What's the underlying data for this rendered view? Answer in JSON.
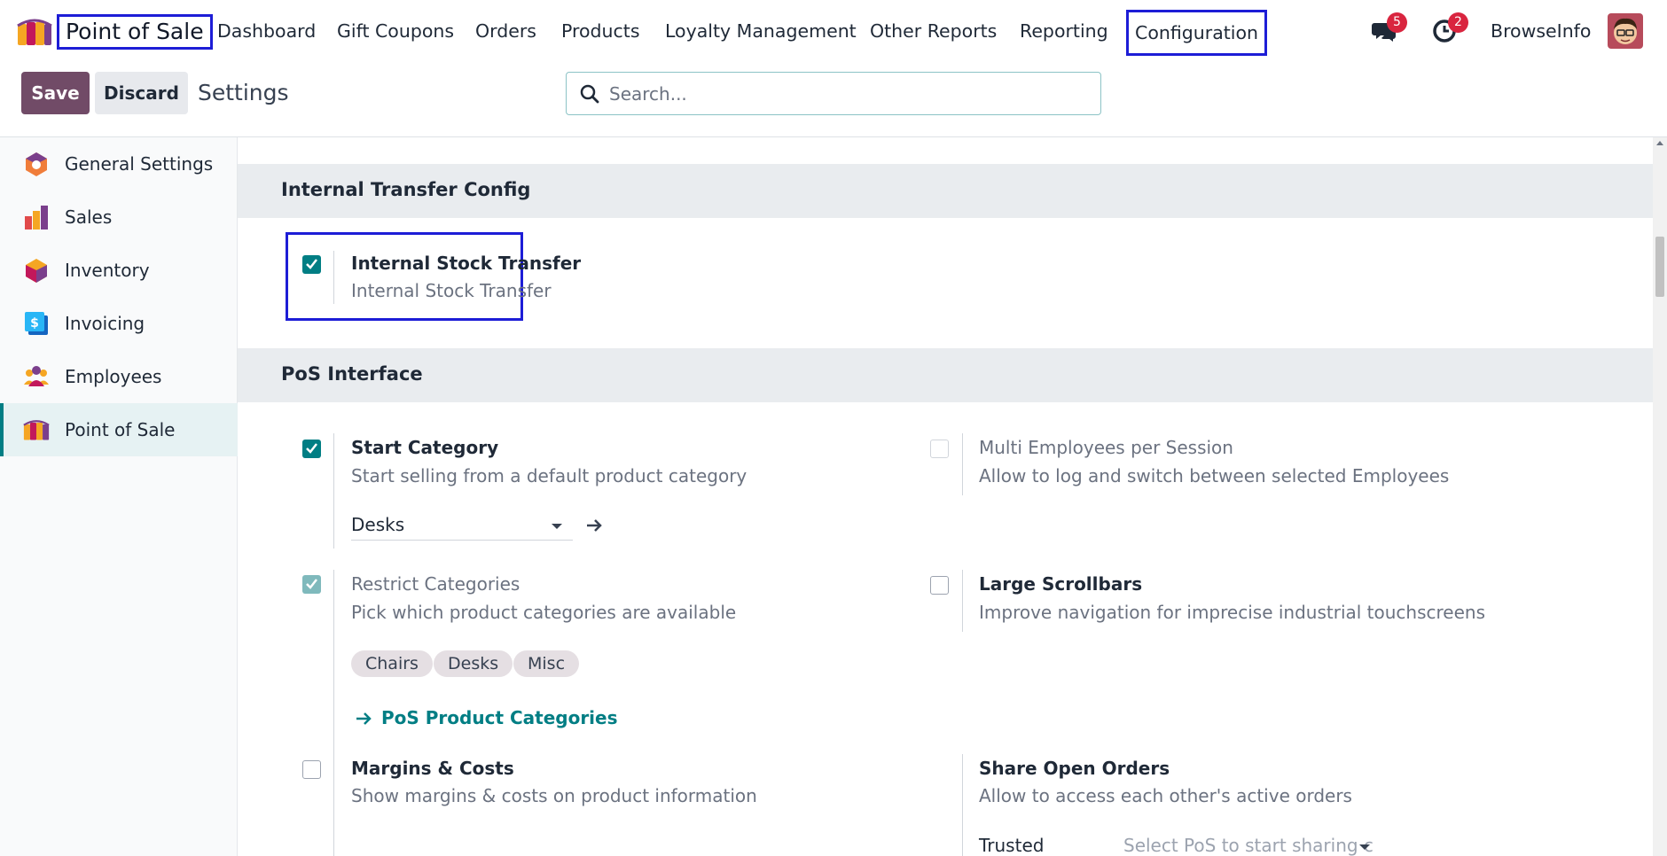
{
  "navbar": {
    "app_name": "Point of Sale",
    "menu": [
      "Dashboard",
      "Gift Coupons",
      "Orders",
      "Products",
      "Loyalty Management",
      "Other Reports",
      "Reporting",
      "Configuration"
    ],
    "messages_count": "5",
    "activities_count": "2",
    "company": "BrowseInfo"
  },
  "control_panel": {
    "save_label": "Save",
    "discard_label": "Discard",
    "breadcrumb": "Settings",
    "search_placeholder": "Search..."
  },
  "sidebar": {
    "items": [
      {
        "label": "General Settings",
        "icon": "general-settings-icon"
      },
      {
        "label": "Sales",
        "icon": "sales-icon"
      },
      {
        "label": "Inventory",
        "icon": "inventory-icon"
      },
      {
        "label": "Invoicing",
        "icon": "invoicing-icon"
      },
      {
        "label": "Employees",
        "icon": "employees-icon"
      },
      {
        "label": "Point of Sale",
        "icon": "point-of-sale-icon",
        "active": true
      }
    ]
  },
  "sections": {
    "internal_transfer": {
      "title": "Internal Transfer Config",
      "stock_transfer": {
        "title": "Internal Stock Transfer",
        "desc": "Internal Stock Transfer",
        "checked": true
      }
    },
    "pos_interface": {
      "title": "PoS Interface",
      "start_category": {
        "title": "Start Category",
        "desc": "Start selling from a default product category",
        "value": "Desks",
        "checked": true
      },
      "multi_employees": {
        "title": "Multi Employees per Session",
        "desc": "Allow to log and switch between selected Employees",
        "checked": false
      },
      "restrict_categories": {
        "title": "Restrict Categories",
        "desc": "Pick which product categories are available",
        "checked": true,
        "tags": [
          "Chairs",
          "Desks",
          "Misc"
        ],
        "link_label": "PoS Product Categories"
      },
      "large_scrollbars": {
        "title": "Large Scrollbars",
        "desc": "Improve navigation for imprecise industrial touchscreens",
        "checked": false
      },
      "margins_costs": {
        "title": "Margins & Costs",
        "desc": "Show margins & costs on product information",
        "checked": false
      },
      "share_open_orders": {
        "title": "Share Open Orders",
        "desc": "Allow to access each other's active orders",
        "trusted_label": "Trusted",
        "trusted_placeholder": "Select PoS to start sharing c"
      }
    }
  },
  "colors": {
    "brand": "#714b67",
    "accent": "#017e84",
    "highlight": "#1d1dd6",
    "badge": "#d9253f"
  }
}
